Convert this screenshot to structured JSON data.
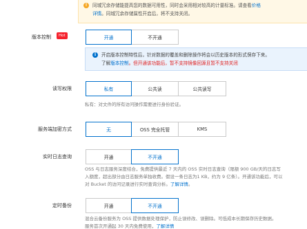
{
  "redundancy_notice": {
    "line1": "同城冗余存储能提高您的数据可用性，同时会采用相对较高的计量标准。请查看",
    "line1_link": "价格",
    "line2_link": "详情",
    "line2": "。同城冗余存储属性开启后，将不支持关闭。"
  },
  "versioning": {
    "label": "版本控制",
    "badge": "Hot",
    "options": [
      "开通",
      "不开通"
    ],
    "selected": "开通",
    "info_line1": "开启版本控制特性后，针对数据的覆盖和删除操作将会以历史版本的形式保存下来。",
    "info_line2_prefix": "了解",
    "info_line2_link": "版本控制",
    "info_line2_warning": "。但开通该功能后，暂不支持镜像回源且暂不支持关闭"
  },
  "acl": {
    "label": "读写权限",
    "options": [
      "私有",
      "公共读",
      "公共读写"
    ],
    "selected": "私有",
    "help": "私有：对文件的所有访问操作需要进行身份验证。"
  },
  "encryption": {
    "label": "服务端加密方式",
    "options": [
      "无",
      "OSS 完全托管",
      "KMS"
    ],
    "selected": "无"
  },
  "realtime_log": {
    "label": "实时日志查询",
    "options": [
      "开通",
      "不开通"
    ],
    "selected": "不开通",
    "help_line1": "OSS 与日志服务深度结合，免费提供最近 7 天内的 OSS 实时日志查询（限额 900 GB/天的日志写",
    "help_line2": "入额度，超出部分由日志服务单独收费。假设一条日志为1 KB，约为 9 亿条）。开通该功能后，可以",
    "help_line3_prefix": "对 Bucket 的访问记录进行实时查询分析。",
    "help_line3_link": "了解详情",
    "help_line3_suffix": "。"
  },
  "scheduled_backup": {
    "label": "定时备份",
    "options": [
      "开通",
      "不开通"
    ],
    "selected": "不开通",
    "help_line1": "混合云备份服务为 OSS 提供数据处理保护，防止误修改、误删除。可低成本长期保存历史数据。",
    "help_line2_prefix": "服务首次开通起 30 天内免费使用，",
    "help_line2_link": "了解详情"
  },
  "colors": {
    "accent": "#0070cc",
    "hot_badge": "#f5222d",
    "warning_bg": "#fff8e6",
    "info_bg": "#eaf3fd",
    "danger_text": "#e02020"
  }
}
